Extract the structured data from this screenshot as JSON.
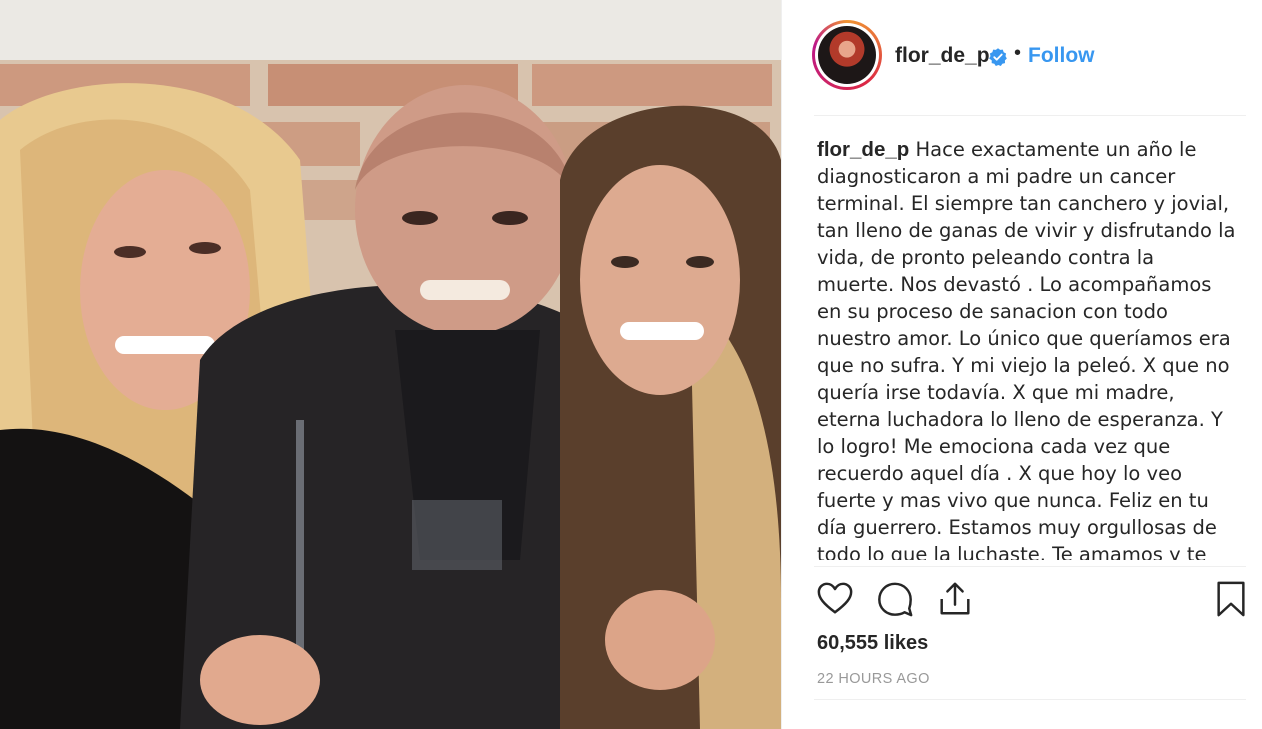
{
  "post": {
    "username": "flor_de_p",
    "verified": true,
    "separator": "•",
    "follow_label": "Follow",
    "caption_user": "flor_de_p",
    "caption_text": "Hace exactamente un año le diagnosticaron a mi padre un cancer terminal. El siempre tan canchero y jovial, tan lleno de ganas de vivir y disfrutando la vida, de pronto peleando contra la muerte. Nos devastó . Lo acompañamos en su proceso de sanacion con todo nuestro amor. Lo único que queríamos era que no sufra. Y mi viejo la peleó. X que no quería irse todavía. X que mi madre, eterna luchadora lo lleno de esperanza. Y lo logro! Me emociona cada vez que recuerdo aquel día . X que hoy lo veo fuerte y mas vivo que nunca. Feliz en tu día guerrero. Estamos muy orgullosas de todo lo que la luchaste. Te amamos y te admiramos. Gracias x",
    "likes": "60,555 likes",
    "timestamp": "22 HOURS AGO"
  },
  "icons": {
    "like": "heart-icon",
    "comment": "comment-icon",
    "share": "share-icon",
    "save": "bookmark-icon",
    "verified": "verified-badge-icon"
  },
  "colors": {
    "link_blue": "#3897f0",
    "text": "#262626",
    "muted": "#999999",
    "verified_blue": "#3897f0"
  }
}
